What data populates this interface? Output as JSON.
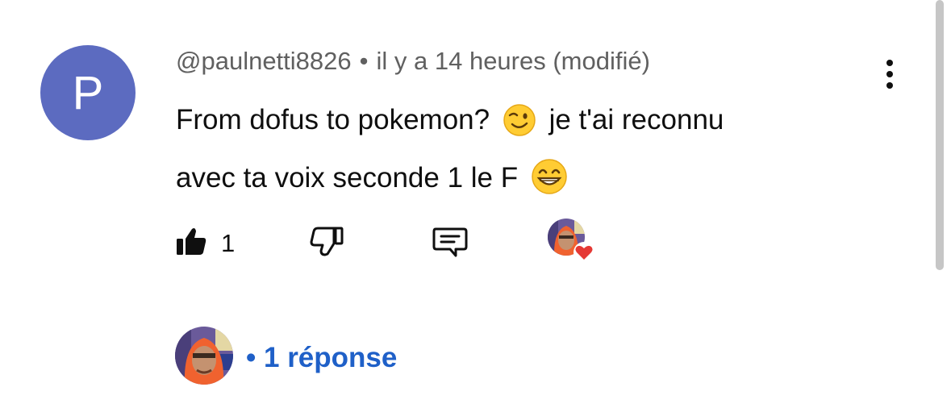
{
  "comment": {
    "avatar_letter": "P",
    "avatar_color": "#5c6bc0",
    "author": "@paulnetti8826",
    "separator": "•",
    "time": "il y a 14 heures (modifié)",
    "text_line1_a": "From dofus to pokemon?",
    "text_line1_b": "je t'ai reconnu",
    "text_line2": "avec ta voix seconde 1 le F",
    "emoji1": "winking-face",
    "emoji2": "grinning-face-with-smiling-eyes"
  },
  "actions": {
    "like_count": "1",
    "icons": [
      "thumbs-up-icon",
      "thumbs-down-icon",
      "reply-icon",
      "creator-heart-icon"
    ]
  },
  "replies": {
    "separator": "•",
    "label": "1 réponse"
  },
  "colors": {
    "link_blue": "#1f60c8",
    "meta_gray": "#606060",
    "heart_red": "#e53935"
  }
}
